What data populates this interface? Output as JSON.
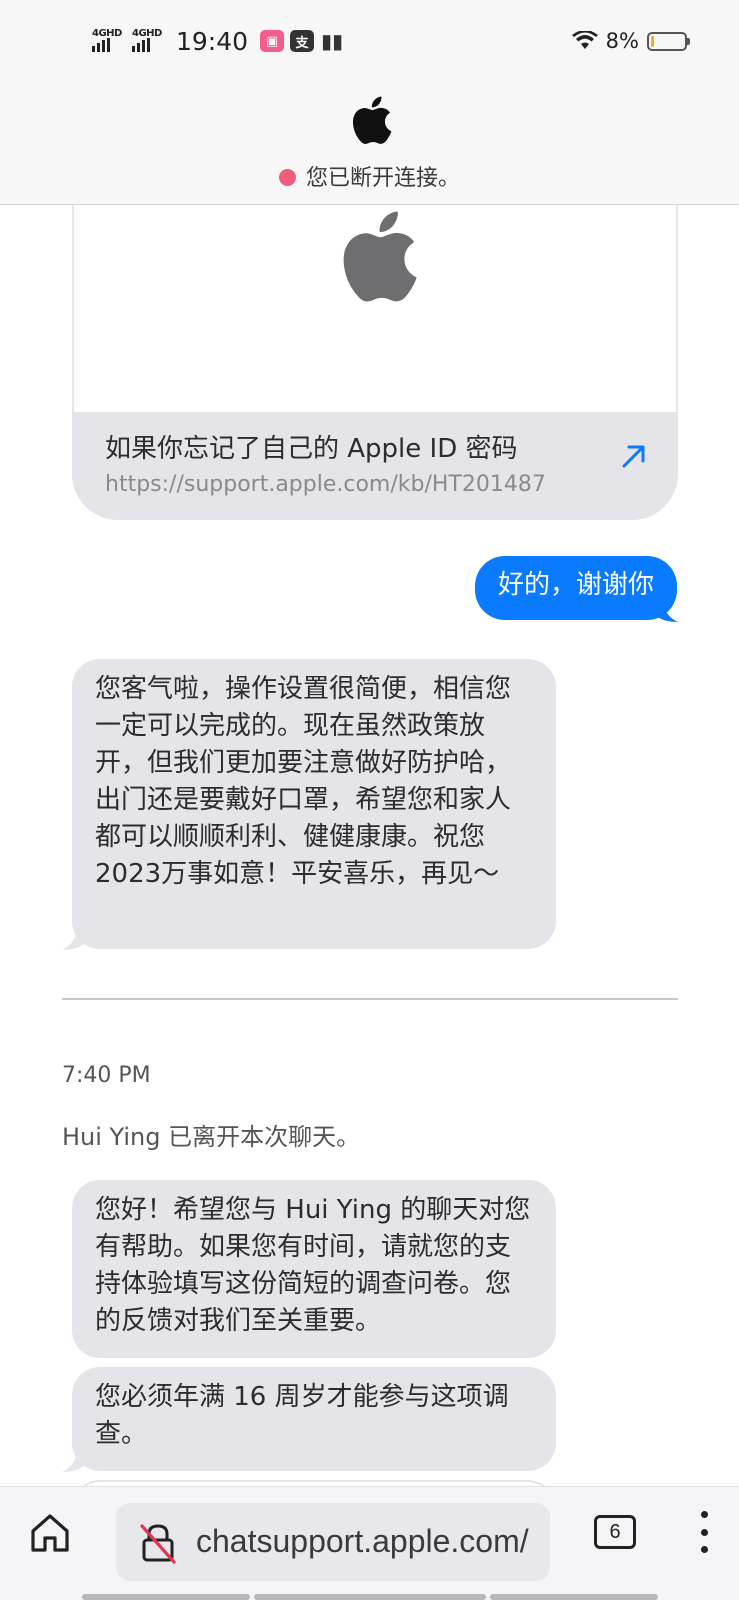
{
  "status_bar": {
    "network_1": "4GHD",
    "network_2": "4GHD",
    "time": "19:40",
    "app_icons": [
      "bilibili-icon",
      "alipay-icon",
      "book-icon"
    ],
    "battery_percent": "8%",
    "battery_level": 0.08
  },
  "header": {
    "logo": "apple-logo-icon",
    "connection_status": "您已断开连接。",
    "status_color": "#ee5d7f"
  },
  "link_card": {
    "title": "如果你忘记了自己的 Apple ID 密码",
    "url": "https://support.apple.com/kb/HT201487"
  },
  "messages": {
    "outgoing_1": "好的，谢谢你",
    "incoming_1": "您客气啦，操作设置很简便，相信您一定可以完成的。现在虽然政策放开，但我们更加要注意做好防护哈，出门还是要戴好口罩，希望您和家人都可以顺顺利利、健健康康。祝您2023万事如意！平安喜乐，再见～",
    "timestamp": "7:40 PM",
    "system_notice": "Hui Ying 已离开本次聊天。",
    "incoming_2": "您好！希望您与 Hui Ying 的聊天对您有帮助。如果您有时间，请就您的支持体验填写这份简短的调查问卷。您的反馈对我们至关重要。",
    "incoming_3": "您必须年满 16 周岁才能参与这项调查。"
  },
  "colors": {
    "outgoing_bubble": "#0a7aff",
    "incoming_bubble": "#e4e4e9",
    "accent_link": "#0a7aff"
  },
  "browser": {
    "url": "chatsupport.apple.com/",
    "tab_count": "6"
  }
}
